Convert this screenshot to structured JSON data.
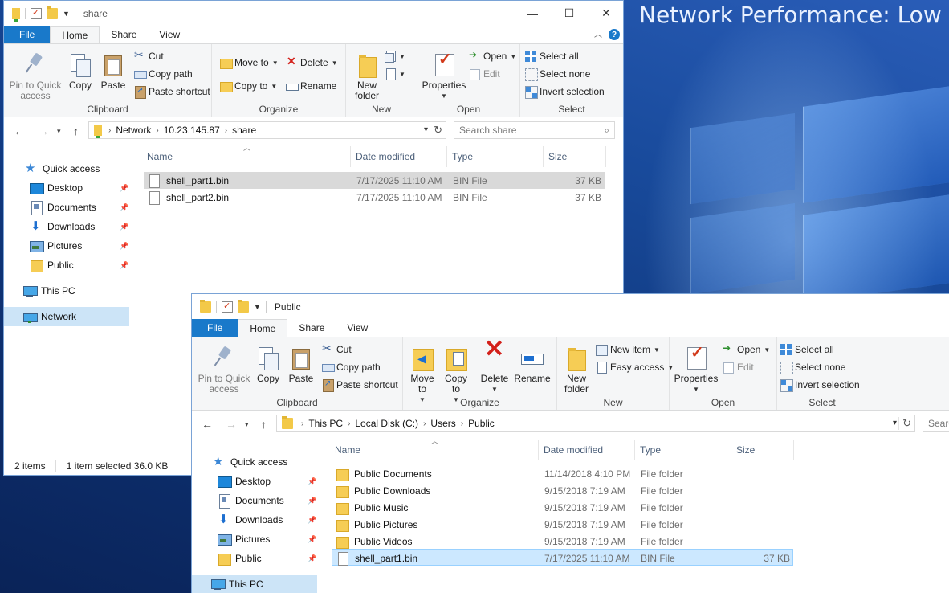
{
  "desktop": {
    "banner": "Network Performance: Low"
  },
  "win1": {
    "title": "share",
    "tabs": {
      "file": "File",
      "home": "Home",
      "share": "Share",
      "view": "View"
    },
    "help": "?",
    "ribbon": {
      "clipboard": {
        "pin": "Pin to Quick access",
        "copy": "Copy",
        "paste": "Paste",
        "cut": "Cut",
        "copy_path": "Copy path",
        "paste_shortcut": "Paste shortcut",
        "label": "Clipboard"
      },
      "organize": {
        "move_to": "Move to",
        "copy_to": "Copy to",
        "delete": "Delete",
        "rename": "Rename",
        "label": "Organize"
      },
      "new": {
        "new_folder": "New folder",
        "label": "New"
      },
      "open": {
        "properties": "Properties",
        "open": "Open",
        "edit": "Edit",
        "label": "Open"
      },
      "select": {
        "select_all": "Select all",
        "select_none": "Select none",
        "invert": "Invert selection",
        "label": "Select"
      }
    },
    "address": [
      "Network",
      "10.23.145.87",
      "share"
    ],
    "search_placeholder": "Search share",
    "nav": {
      "quick_access": "Quick access",
      "items": [
        "Desktop",
        "Documents",
        "Downloads",
        "Pictures",
        "Public"
      ],
      "this_pc": "This PC",
      "network": "Network"
    },
    "columns": {
      "name": "Name",
      "date": "Date modified",
      "type": "Type",
      "size": "Size"
    },
    "files": [
      {
        "name": "shell_part1.bin",
        "date": "7/17/2025 11:10 AM",
        "type": "BIN File",
        "size": "37 KB"
      },
      {
        "name": "shell_part2.bin",
        "date": "7/17/2025 11:10 AM",
        "type": "BIN File",
        "size": "37 KB"
      }
    ],
    "status": {
      "count": "2 items",
      "selected": "1 item selected  36.0 KB"
    }
  },
  "win2": {
    "title": "Public",
    "tabs": {
      "file": "File",
      "home": "Home",
      "share": "Share",
      "view": "View"
    },
    "ribbon": {
      "clipboard": {
        "pin": "Pin to Quick access",
        "copy": "Copy",
        "paste": "Paste",
        "cut": "Cut",
        "copy_path": "Copy path",
        "paste_shortcut": "Paste shortcut",
        "label": "Clipboard"
      },
      "organize": {
        "move_to": "Move to",
        "copy_to": "Copy to",
        "delete": "Delete",
        "rename": "Rename",
        "label": "Organize"
      },
      "new": {
        "new_folder": "New folder",
        "new_item": "New item",
        "easy_access": "Easy access",
        "label": "New"
      },
      "open": {
        "properties": "Properties",
        "open": "Open",
        "edit": "Edit",
        "label": "Open"
      },
      "select": {
        "select_all": "Select all",
        "select_none": "Select none",
        "invert": "Invert selection",
        "label": "Select"
      }
    },
    "address": [
      "This PC",
      "Local Disk (C:)",
      "Users",
      "Public"
    ],
    "search_placeholder": "Search",
    "nav": {
      "quick_access": "Quick access",
      "items": [
        "Desktop",
        "Documents",
        "Downloads",
        "Pictures",
        "Public"
      ],
      "this_pc": "This PC"
    },
    "columns": {
      "name": "Name",
      "date": "Date modified",
      "type": "Type",
      "size": "Size"
    },
    "files": [
      {
        "name": "Public Documents",
        "date": "11/14/2018 4:10 PM",
        "type": "File folder",
        "size": "",
        "kind": "folder"
      },
      {
        "name": "Public Downloads",
        "date": "9/15/2018 7:19 AM",
        "type": "File folder",
        "size": "",
        "kind": "folder"
      },
      {
        "name": "Public Music",
        "date": "9/15/2018 7:19 AM",
        "type": "File folder",
        "size": "",
        "kind": "folder"
      },
      {
        "name": "Public Pictures",
        "date": "9/15/2018 7:19 AM",
        "type": "File folder",
        "size": "",
        "kind": "folder"
      },
      {
        "name": "Public Videos",
        "date": "9/15/2018 7:19 AM",
        "type": "File folder",
        "size": "",
        "kind": "folder"
      },
      {
        "name": "shell_part1.bin",
        "date": "7/17/2025 11:10 AM",
        "type": "BIN File",
        "size": "37 KB",
        "kind": "file"
      }
    ]
  },
  "colors": {
    "accent": "#1979ca",
    "selection": "#cce8ff",
    "selection_border": "#99d1ff",
    "hover": "#d9d9d9",
    "nav_selected": "#cce4f7"
  }
}
